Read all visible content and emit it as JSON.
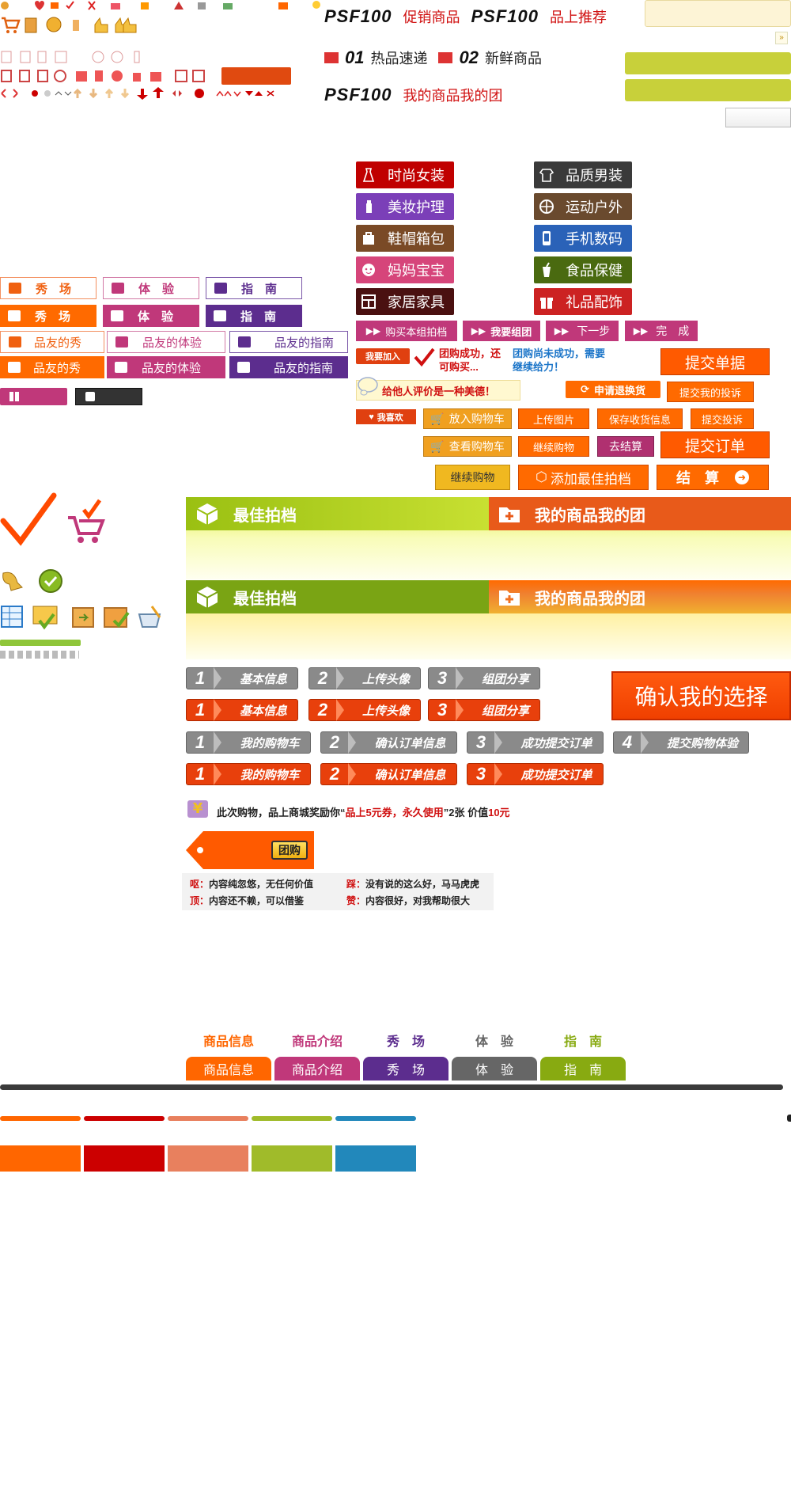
{
  "colors": {
    "orange": "#ff6600",
    "red": "#cc0000",
    "magenta": "#c0387a",
    "purple": "#5c2d8e",
    "green": "#88aa11",
    "blue": "#2a6ebb",
    "brown": "#7a4a26",
    "dark": "#333333",
    "olive": "#6a8a1a"
  },
  "headings": {
    "psf1": "PSF100",
    "promo": "促销商品",
    "psf2": "PSF100",
    "recommend": "品上推荐",
    "n01": "01",
    "hot": "热品速递",
    "n02": "02",
    "fresh": "新鲜商品",
    "psf3": "PSF100",
    "mygroup": "我的商品我的团"
  },
  "categories": [
    {
      "label": "时尚女装",
      "color": "#c00000",
      "icon": "dress-icon"
    },
    {
      "label": "品质男装",
      "color": "#3a3a3a",
      "icon": "shirt-icon"
    },
    {
      "label": "美妆护理",
      "color": "#7b3fb8",
      "icon": "bottle-icon"
    },
    {
      "label": "运动户外",
      "color": "#6a4a2e",
      "icon": "ball-icon"
    },
    {
      "label": "鞋帽箱包",
      "color": "#7a4a26",
      "icon": "bag-icon"
    },
    {
      "label": "手机数码",
      "color": "#2a62b8",
      "icon": "phone-icon"
    },
    {
      "label": "妈妈宝宝",
      "color": "#d6457a",
      "icon": "baby-icon"
    },
    {
      "label": "食品保健",
      "color": "#4a6a10",
      "icon": "cup-icon"
    },
    {
      "label": "家居家具",
      "color": "#4a1010",
      "icon": "cabinet-icon"
    },
    {
      "label": "礼品配饰",
      "color": "#cc2222",
      "icon": "gift-icon"
    }
  ],
  "tabs_short": [
    "秀　场",
    "体　验",
    "指　南"
  ],
  "tabs_long": [
    "品友的秀",
    "品友的体验",
    "品友的指南"
  ],
  "actions": {
    "buy_group": "购买本组拍档",
    "join_group": "我要组团",
    "next": "下一步",
    "done": "完　成",
    "join": "我要加入",
    "success": "团购成功，还可购买...",
    "fail": "团购尚未成功，需要继续给力！",
    "submit_doc": "提交单据",
    "comment": "给他人评价是一种美德！",
    "refund": "申请退换货",
    "my_complaint": "提交我的投诉",
    "like": "我喜欢",
    "add_cart": "放入购物车",
    "upload": "上传图片",
    "save_addr": "保存收货信息",
    "complaint": "提交投诉",
    "view_cart": "查看购物车",
    "continue": "继续购物",
    "checkout": "去结算",
    "submit_order": "提交订单",
    "continue2": "继续购物",
    "add_best": "添加最佳拍档",
    "settle": "结　算"
  },
  "banners": {
    "best": "最佳拍档",
    "mine": "我的商品我的团"
  },
  "steps_a": [
    {
      "n": "1",
      "label": "基本信息"
    },
    {
      "n": "2",
      "label": "上传头像"
    },
    {
      "n": "3",
      "label": "组团分享"
    }
  ],
  "steps_b": [
    {
      "n": "1",
      "label": "我的购物车"
    },
    {
      "n": "2",
      "label": "确认订单信息"
    },
    {
      "n": "3",
      "label": "成功提交订单"
    },
    {
      "n": "4",
      "label": "提交购物体验"
    }
  ],
  "confirm": "确认我的选择",
  "reward": {
    "pre": "此次购物，品上商城奖励你“",
    "coupon": "品上5元券，永久使用",
    "mid": "”2张 价值",
    "value": "10元"
  },
  "tuangou": "团购",
  "ratings": [
    {
      "tag": "呕：",
      "text": "内容纯忽悠，无任何价值"
    },
    {
      "tag": "踩：",
      "text": "没有说的这么好，马马虎虎"
    },
    {
      "tag": "顶：",
      "text": "内容还不赖，可以借鉴"
    },
    {
      "tag": "赞：",
      "text": "内容很好，对我帮助很大"
    }
  ],
  "navtabs": [
    {
      "label": "商品信息",
      "color": "#ff6600"
    },
    {
      "label": "商品介绍",
      "color": "#c0387a"
    },
    {
      "label": "秀　场",
      "color": "#5c2d8e"
    },
    {
      "label": "体　验",
      "color": "#666666"
    },
    {
      "label": "指　南",
      "color": "#88aa11"
    }
  ],
  "swatches": [
    "#ff6600",
    "#cc0000",
    "#e8805e",
    "#a0bb2a",
    "#2288bb"
  ]
}
